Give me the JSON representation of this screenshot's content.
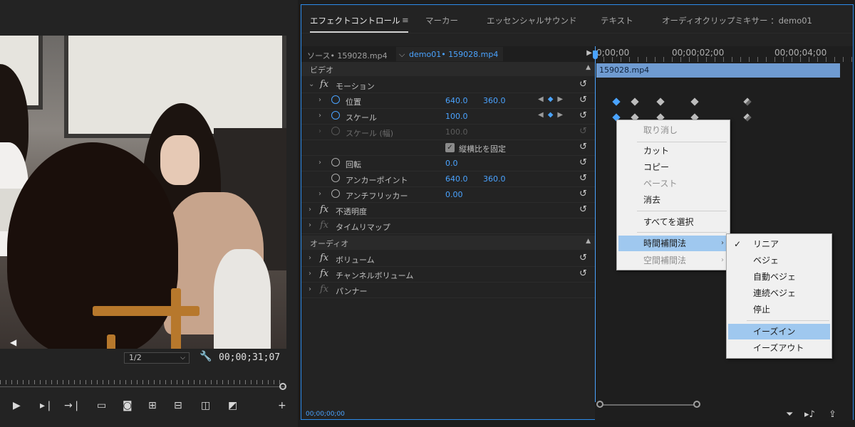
{
  "monitor": {
    "zoom": "1/2",
    "timecode": "00;00;31;07"
  },
  "tabs": [
    {
      "label": "エフェクトコントロール",
      "active": true
    },
    {
      "label": "マーカー"
    },
    {
      "label": "エッセンシャルサウンド"
    },
    {
      "label": "テキスト"
    },
    {
      "label": "オーディオクリップミキサー ：demo01"
    }
  ],
  "source": {
    "label": "ソース•  159028.mp4",
    "sequence": "demo01• 159028.mp4"
  },
  "sections": {
    "video": "ビデオ",
    "audio": "オーディオ"
  },
  "effects": {
    "motion": "モーション",
    "position": {
      "label": "位置",
      "x": "640.0",
      "y": "360.0"
    },
    "scale": {
      "label": "スケール",
      "value": "100.0"
    },
    "scale_width": {
      "label": "スケール (幅)",
      "value": "100.0"
    },
    "uniform_scale": "縦横比を固定",
    "rotation": {
      "label": "回転",
      "value": "0.0"
    },
    "anchor": {
      "label": "アンカーポイント",
      "x": "640.0",
      "y": "360.0"
    },
    "antiflicker": {
      "label": "アンチフリッカー",
      "value": "0.00"
    },
    "opacity": "不透明度",
    "time_remap": "タイムリマップ",
    "volume": "ボリューム",
    "channel_volume": "チャンネルボリューム",
    "panner": "パンナー"
  },
  "timeline": {
    "ticks": [
      "0;00;00",
      "00;00;02;00",
      "00;00;04;00"
    ],
    "clip": "159028.mp4"
  },
  "bottom_timecode": "00;00;00;00",
  "context_menu": {
    "undo": "取り消し",
    "cut": "カット",
    "copy": "コピー",
    "paste": "ペースト",
    "clear": "消去",
    "select_all": "すべてを選択",
    "temporal": "時間補間法",
    "spatial": "空間補間法"
  },
  "submenu": {
    "linear": "リニア",
    "bezier": "ベジェ",
    "auto_bezier": "自動ベジェ",
    "continuous_bezier": "連続ベジェ",
    "hold": "停止",
    "ease_in": "イーズイン",
    "ease_out": "イーズアウト"
  },
  "colors": {
    "accent": "#4aa3ff",
    "highlight": "#9fc8ef",
    "clip": "#6f9bd1"
  }
}
